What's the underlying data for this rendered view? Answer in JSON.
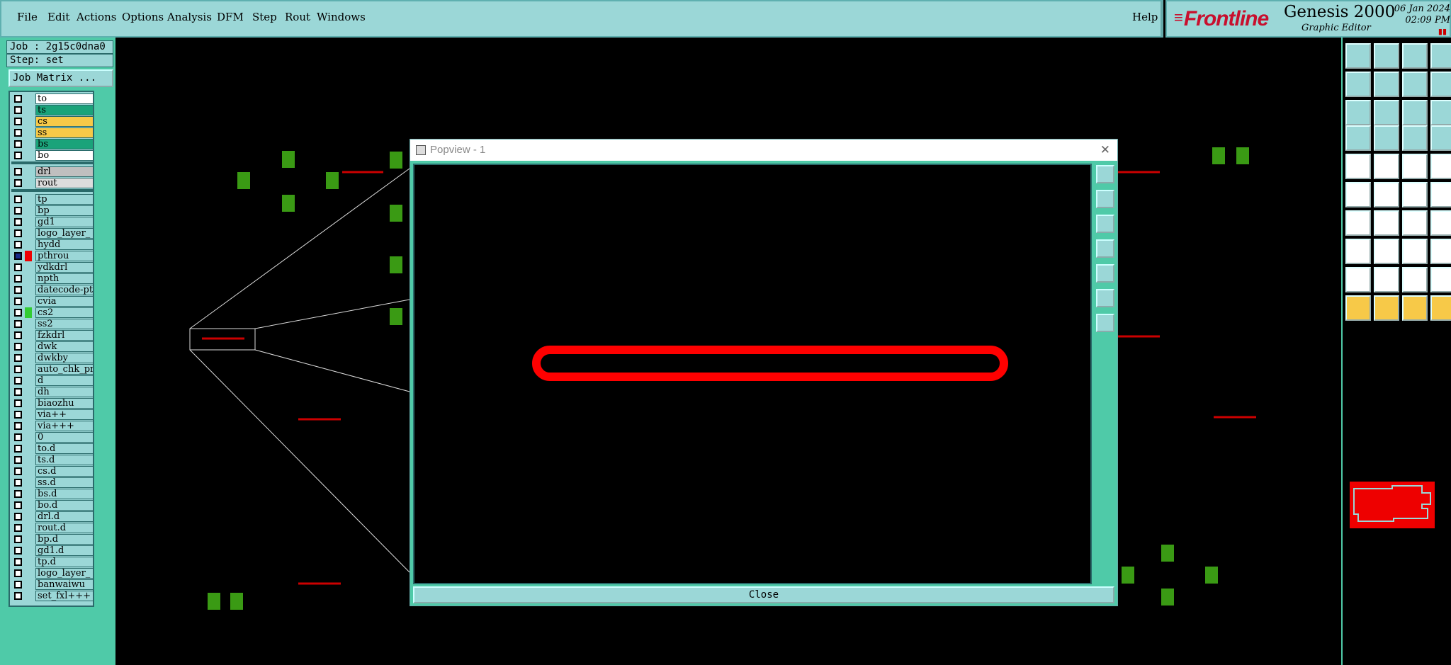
{
  "menu": [
    "File",
    "Edit",
    "Actions",
    "Options",
    "Analysis",
    "DFM",
    "Step",
    "Rout",
    "Windows",
    "Help"
  ],
  "brand": {
    "logo": "Frontline",
    "product": "Genesis 2000",
    "subtitle": "Graphic Editor",
    "date": "06 Jan 2024",
    "time": "02:09 PM"
  },
  "info": {
    "job": "Job : 2g15c0dna0",
    "step": "Step: set",
    "job_matrix": "Job Matrix ..."
  },
  "layers": [
    {
      "name": "to",
      "color": "#ffffff"
    },
    {
      "name": "ts",
      "color": "#1aa37a"
    },
    {
      "name": "cs",
      "color": "#f7c948"
    },
    {
      "name": "ss",
      "color": "#f7c948"
    },
    {
      "name": "bs",
      "color": "#1aa37a"
    },
    {
      "name": "bo",
      "color": "#ffffff"
    },
    {
      "name": "drl",
      "color": "#bfbfbf"
    },
    {
      "name": "rout",
      "color": "#dddddd"
    },
    {
      "name": "tp"
    },
    {
      "name": "bp"
    },
    {
      "name": "gd1"
    },
    {
      "name": "logo_layer_"
    },
    {
      "name": "hydd"
    },
    {
      "name": "pthrou",
      "affected": true
    },
    {
      "name": "ydkdrl"
    },
    {
      "name": "npth"
    },
    {
      "name": "datecode-pt"
    },
    {
      "name": "cvia"
    },
    {
      "name": "cs2",
      "marker": "#33cc33"
    },
    {
      "name": "ss2"
    },
    {
      "name": "fzkdrl"
    },
    {
      "name": "dwk"
    },
    {
      "name": "dwkby"
    },
    {
      "name": "auto_chk_pn"
    },
    {
      "name": "d"
    },
    {
      "name": "dh"
    },
    {
      "name": "biaozhu"
    },
    {
      "name": "via++"
    },
    {
      "name": "via+++"
    },
    {
      "name": "0"
    },
    {
      "name": "to.d"
    },
    {
      "name": "ts.d"
    },
    {
      "name": "cs.d"
    },
    {
      "name": "ss.d"
    },
    {
      "name": "bs.d"
    },
    {
      "name": "bo.d"
    },
    {
      "name": "drl.d"
    },
    {
      "name": "rout.d"
    },
    {
      "name": "bp.d"
    },
    {
      "name": "gd1.d"
    },
    {
      "name": "tp.d"
    },
    {
      "name": "logo_layer_"
    },
    {
      "name": "banwaiwu"
    },
    {
      "name": "set_fxl+++"
    }
  ],
  "popup": {
    "title": "Popview - 1",
    "close_label": "Close"
  },
  "colors": {
    "panel": "#9bd7d7",
    "panel_dark": "#4fcaa8",
    "feature_red": "#ff0000",
    "pad_green": "#3a9a14"
  }
}
